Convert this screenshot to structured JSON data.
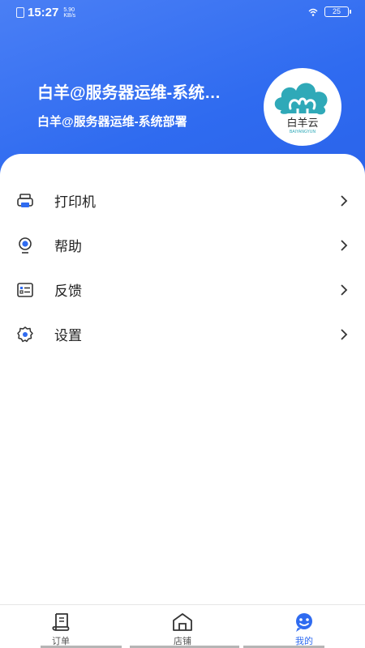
{
  "status_bar": {
    "time": "15:27",
    "net_speed": "5.90",
    "net_unit": "KB/s",
    "battery": "25"
  },
  "profile": {
    "name": "白羊@服务器运维-系统…",
    "subtitle": "白羊@服务器运维-系统部署",
    "logo_text": "白羊云",
    "logo_subtext": "BAIYANGYUN",
    "logo_color": "#2fa9b8"
  },
  "menu": [
    {
      "label": "打印机",
      "icon": "printer-icon"
    },
    {
      "label": "帮助",
      "icon": "lightbulb-icon"
    },
    {
      "label": "反馈",
      "icon": "feedback-icon"
    },
    {
      "label": "设置",
      "icon": "gear-icon"
    }
  ],
  "tabs": [
    {
      "label": "订单",
      "icon": "order-icon",
      "active": false
    },
    {
      "label": "店铺",
      "icon": "shop-icon",
      "active": false
    },
    {
      "label": "我的",
      "icon": "profile-face-icon",
      "active": true
    }
  ],
  "colors": {
    "accent": "#2f6bf0",
    "header": "#3a74f2",
    "text": "#222222"
  }
}
